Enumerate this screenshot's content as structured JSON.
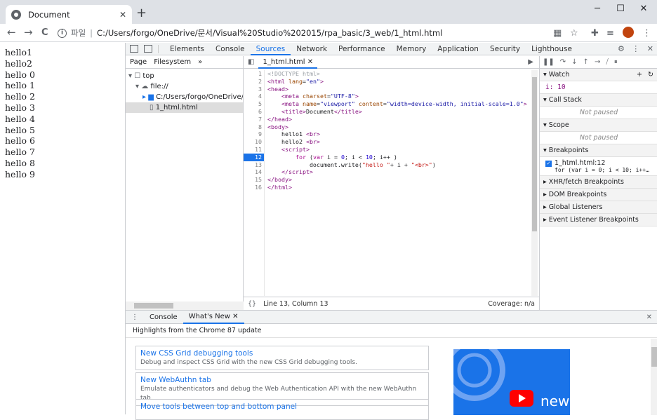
{
  "browser": {
    "tab_title": "Document",
    "tab_close": "✕",
    "new_tab": "+",
    "minimize": "─",
    "maximize": "☐",
    "close": "✕",
    "back": "←",
    "forward": "→",
    "reload": "C",
    "scheme": "파일",
    "url": "C:/Users/forgo/OneDrive/문서/Visual%20Studio%202015/rpa_basic/3_web/1_html.html"
  },
  "page": {
    "lines": [
      "hello1",
      "hello2",
      "hello 0",
      "hello 1",
      "hello 2",
      "hello 3",
      "hello 4",
      "hello 5",
      "hello 6",
      "hello 7",
      "hello 8",
      "hello 9"
    ]
  },
  "devtools": {
    "tabs": [
      "Elements",
      "Console",
      "Sources",
      "Network",
      "Performance",
      "Memory",
      "Application",
      "Security",
      "Lighthouse"
    ],
    "active_tab": "Sources",
    "navigator": {
      "tabs": [
        "Page",
        "Filesystem",
        "»"
      ],
      "tree": [
        {
          "label": "top",
          "depth": 0
        },
        {
          "label": "file://",
          "depth": 1
        },
        {
          "label": "C:/Users/forgo/OneDrive/%EB%",
          "depth": 2
        },
        {
          "label": "1_html.html",
          "depth": 3
        }
      ]
    },
    "editor": {
      "file_tab": "1_html.html",
      "status_left": "Line 13, Column 13",
      "status_right": "Coverage: n/a",
      "breakpoint_line": 12
    },
    "debugger": {
      "watch_title": "Watch",
      "watch_value": "i: 10",
      "call_stack_title": "Call Stack",
      "call_stack_value": "Not paused",
      "scope_title": "Scope",
      "scope_value": "Not paused",
      "breakpoints_title": "Breakpoints",
      "breakpoint_file": "1_html.html:12",
      "breakpoint_code": "for (var i = 0; i < 10; i++…",
      "xhr": "XHR/fetch Breakpoints",
      "dom": "DOM Breakpoints",
      "global": "Global Listeners",
      "event": "Event Listener Breakpoints"
    },
    "drawer": {
      "tabs": [
        "Console",
        "What's New"
      ],
      "active": "What's New",
      "highlight": "Highlights from the Chrome 87 update",
      "cards": [
        {
          "title": "New CSS Grid debugging tools",
          "desc": "Debug and inspect CSS Grid with the new CSS Grid debugging tools."
        },
        {
          "title": "New WebAuthn tab",
          "desc": "Emulate authenticators and debug the Web Authentication API with the new WebAuthn tab."
        },
        {
          "title": "Move tools between top and bottom panel",
          "desc": ""
        }
      ],
      "video_label": "new"
    }
  },
  "colors": {
    "accent": "#1a73e8",
    "youtube": "#ff0000"
  }
}
